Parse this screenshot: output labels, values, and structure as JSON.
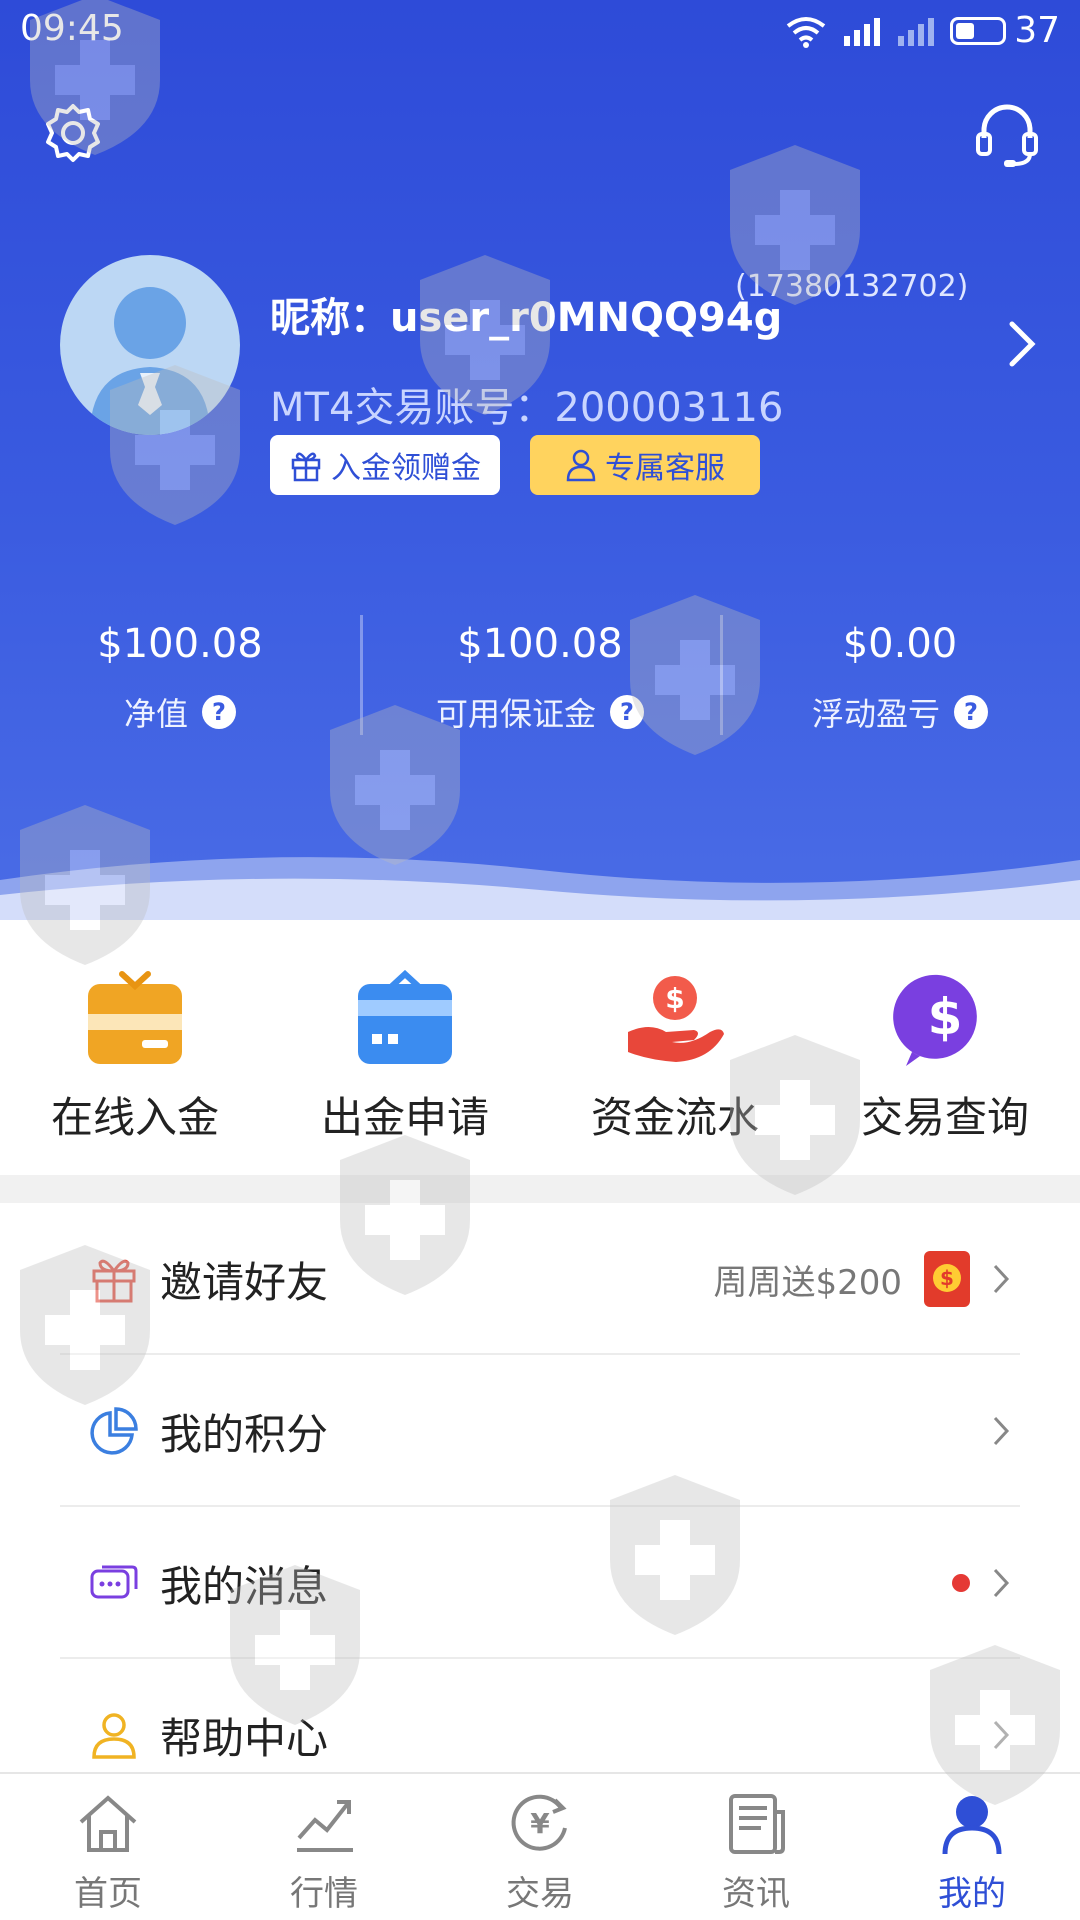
{
  "status_bar": {
    "time": "09:45",
    "battery": "37"
  },
  "profile": {
    "nickname": "昵称：user_r0MNQQ94g",
    "phone": "(17380132702)",
    "account": "MT4交易账号：200003116",
    "btn_deposit_gift": "入金领赠金",
    "btn_exclusive_service": "专属客服"
  },
  "stats": [
    {
      "value": "$100.08",
      "label": "净值"
    },
    {
      "value": "$100.08",
      "label": "可用保证金"
    },
    {
      "value": "$0.00",
      "label": "浮动盈亏"
    }
  ],
  "quick_actions": [
    {
      "label": "在线入金",
      "icon": "wallet-deposit-icon"
    },
    {
      "label": "出金申请",
      "icon": "wallet-withdraw-icon"
    },
    {
      "label": "资金流水",
      "icon": "money-hand-icon"
    },
    {
      "label": "交易查询",
      "icon": "dollar-chat-icon"
    }
  ],
  "menu": [
    {
      "label": "邀请好友",
      "extra": "周周送$200",
      "icon": "gift-icon"
    },
    {
      "label": "我的积分",
      "icon": "pie-chart-icon"
    },
    {
      "label": "我的消息",
      "icon": "message-icon"
    },
    {
      "label": "帮助中心",
      "icon": "user-help-icon"
    }
  ],
  "tabs": [
    {
      "label": "首页",
      "icon": "home-icon"
    },
    {
      "label": "行情",
      "icon": "trend-chart-icon"
    },
    {
      "label": "交易",
      "icon": "yen-exchange-icon"
    },
    {
      "label": "资讯",
      "icon": "news-icon"
    },
    {
      "label": "我的",
      "icon": "user-icon",
      "active": true
    }
  ],
  "colors": {
    "primary": "#2f4fd6",
    "accent_yellow": "#ffd35e",
    "unread_dot": "#e53935"
  }
}
